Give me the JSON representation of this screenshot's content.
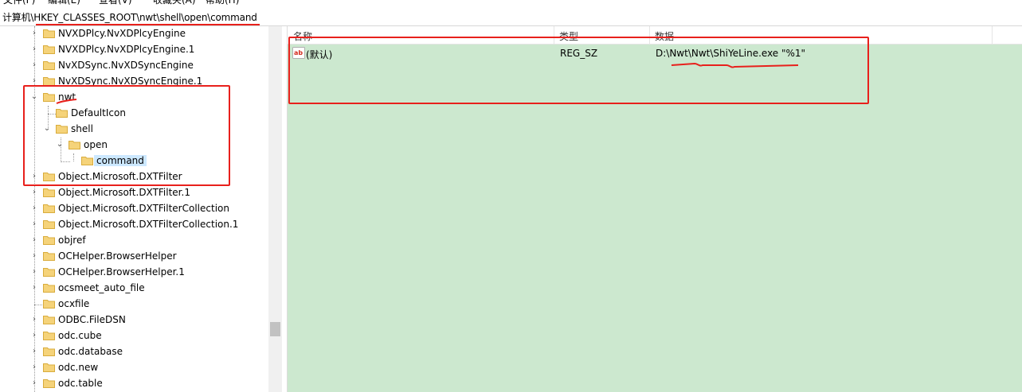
{
  "menubar": {
    "items": [
      "文件(F)",
      "编辑(E)",
      "查看(V)",
      "收藏夹(A)",
      "帮助(H)"
    ]
  },
  "address": {
    "path": "计算机\\HKEY_CLASSES_ROOT\\nwt\\shell\\open\\command"
  },
  "tree": {
    "nodes": [
      "NVXDPlcy.NvXDPlcyEngine",
      "NVXDPlcy.NvXDPlcyEngine.1",
      "NvXDSync.NvXDSyncEngine",
      "NvXDSync.NvXDSyncEngine.1",
      "nwt",
      "DefaultIcon",
      "shell",
      "open",
      "command",
      "Object.Microsoft.DXTFilter",
      "Object.Microsoft.DXTFilter.1",
      "Object.Microsoft.DXTFilterCollection",
      "Object.Microsoft.DXTFilterCollection.1",
      "objref",
      "OCHelper.BrowserHelper",
      "OCHelper.BrowserHelper.1",
      "ocsmeet_auto_file",
      "ocxfile",
      "ODBC.FileDSN",
      "odc.cube",
      "odc.database",
      "odc.new",
      "odc.table"
    ],
    "selected": "command"
  },
  "list": {
    "headers": {
      "name": "名称",
      "type": "类型",
      "data": "数据"
    },
    "rows": [
      {
        "name": "(默认)",
        "type": "REG_SZ",
        "data": "D:\\Nwt\\Nwt\\ShiYeLine.exe \"%1\"",
        "icon": "ab-string-icon"
      }
    ]
  },
  "colors": {
    "list_bg": "#cce8cf",
    "highlight": "#e8201c",
    "selected": "#cce8ff",
    "folder": "#f5d37a"
  }
}
